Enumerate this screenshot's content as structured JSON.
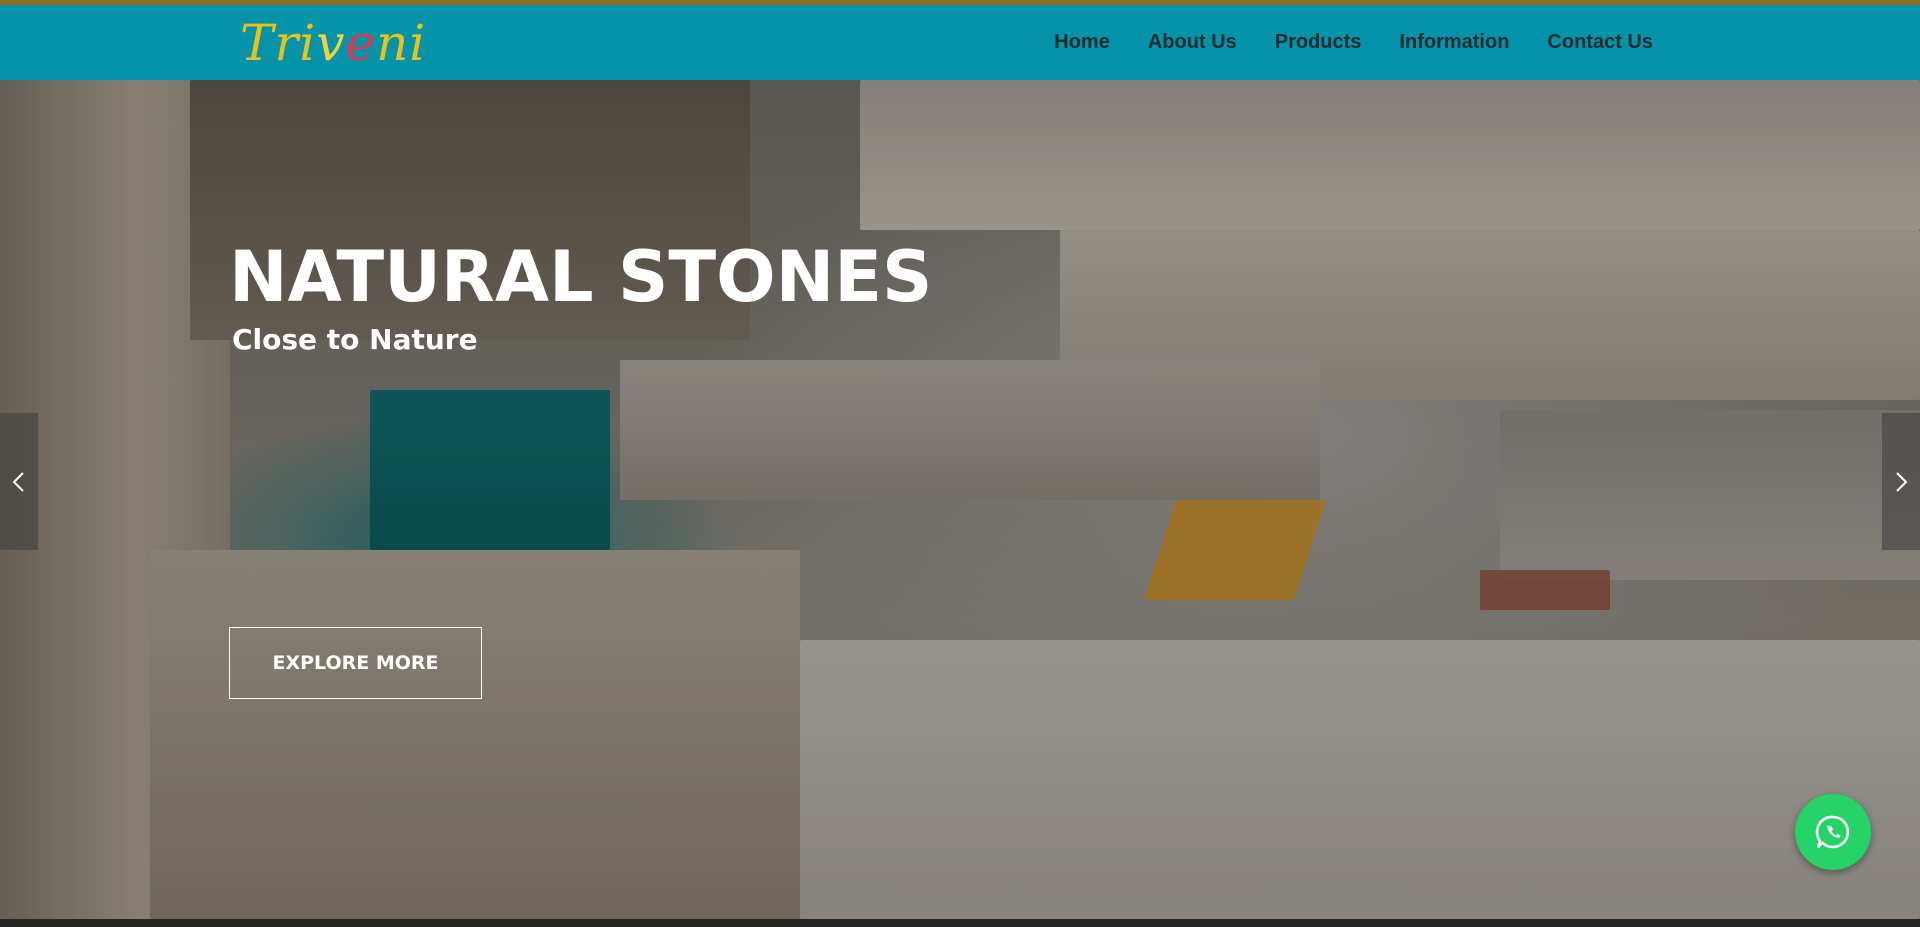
{
  "header": {
    "logo_text": "Triveni",
    "nav": [
      {
        "label": "Home"
      },
      {
        "label": "About Us"
      },
      {
        "label": "Products"
      },
      {
        "label": "Information"
      },
      {
        "label": "Contact Us"
      }
    ]
  },
  "hero": {
    "title": "NATURAL STONES",
    "subtitle": "Close to Nature",
    "cta_label": "EXPLORE MORE",
    "background_image": "marble-quarry-photo",
    "prev_icon": "chevron-left-icon",
    "next_icon": "chevron-right-icon"
  },
  "floating": {
    "whatsapp_icon": "whatsapp-icon"
  },
  "colors": {
    "header_bg": "#0493a8",
    "accent_bar": "#8a6d1e",
    "nav_text": "#1d2a2e",
    "whatsapp": "#25d366"
  }
}
